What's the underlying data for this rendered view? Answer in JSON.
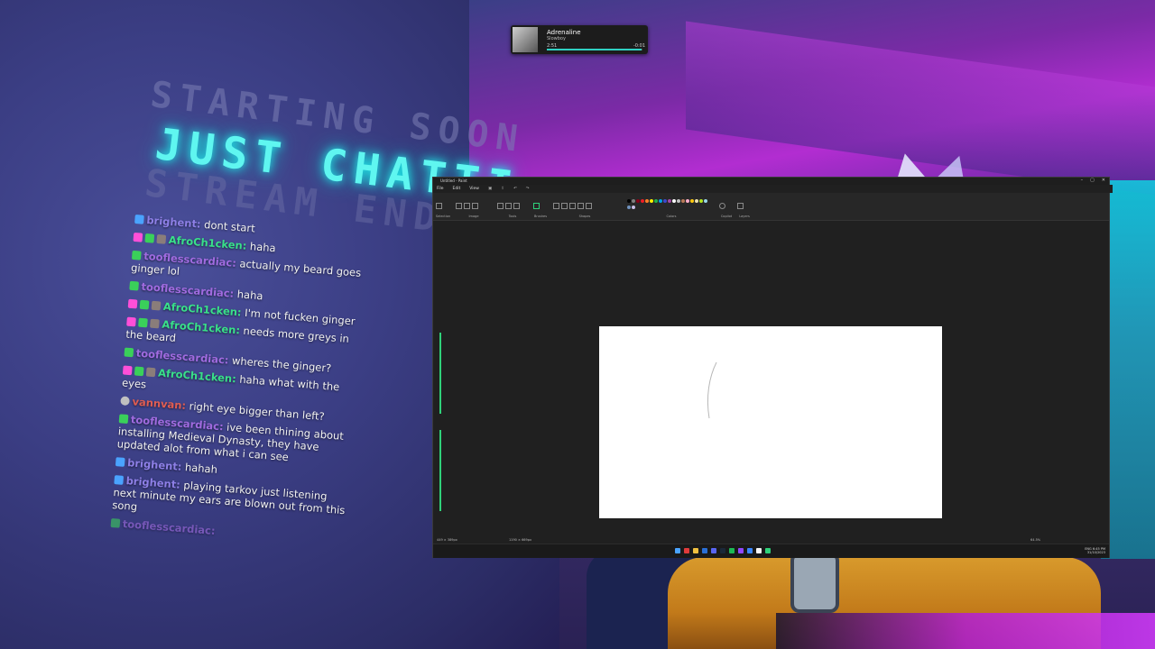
{
  "overlay": {
    "line1": "STARTING SOON",
    "line2": "JUST CHATTI",
    "line3": "STREAM END"
  },
  "chat": [
    {
      "user": "brighent",
      "text": "dont start"
    },
    {
      "user": "AfroCh1cken",
      "text": "haha"
    },
    {
      "user": "tooflesscardiac",
      "text": "actually my beard goes ginger lol"
    },
    {
      "user": "tooflesscardiac",
      "text": "haha"
    },
    {
      "user": "AfroCh1cken",
      "text": "I'm not fucken ginger"
    },
    {
      "user": "AfroCh1cken",
      "text": "needs more greys in the beard"
    },
    {
      "user": "tooflesscardiac",
      "text": "wheres the ginger?"
    },
    {
      "user": "AfroCh1cken",
      "text": "haha what with the eyes"
    },
    {
      "user": "vannvan",
      "text": "right eye bigger than left?"
    },
    {
      "user": "tooflesscardiac",
      "text": "ive been thining about installing Medieval Dynasty, they have updated alot from what i can see"
    },
    {
      "user": "brighent",
      "text": "hahah"
    },
    {
      "user": "brighent",
      "text": "playing tarkov just listening next minute my ears are blown out from this song"
    },
    {
      "user": "tooflesscardiac",
      "text": ""
    }
  ],
  "player": {
    "title": "Adrenaline",
    "artist": "Slowboy",
    "current_time": "2:51",
    "remaining_time": "-0:01",
    "progress": 0.99,
    "accent": "#2fd1c3"
  },
  "paint": {
    "title": "Untitled - Paint",
    "menu": [
      "File",
      "Edit",
      "View"
    ],
    "groups": [
      "Selection",
      "Image",
      "Tools",
      "Brushes",
      "Shapes",
      "Colors",
      "Copilot",
      "Layers"
    ],
    "palette": [
      "#000000",
      "#7f7f7f",
      "#880015",
      "#ed1c24",
      "#ff7f27",
      "#fff200",
      "#22b14c",
      "#00a2e8",
      "#3f48cc",
      "#a349a4",
      "#ffffff",
      "#c3c3c3",
      "#b97a57",
      "#ffaec9",
      "#ffc90e",
      "#efe4b0",
      "#b5e61d",
      "#99d9ea",
      "#7092be",
      "#c8bfe7"
    ],
    "status_left": "449 × 389px",
    "status_mid": "1190 × 669px",
    "zoom": "64.5%",
    "accent": "#2fd27a"
  },
  "taskbar": {
    "time": "6:45 PM",
    "date": "31/10/2023",
    "lang": "ENG"
  }
}
